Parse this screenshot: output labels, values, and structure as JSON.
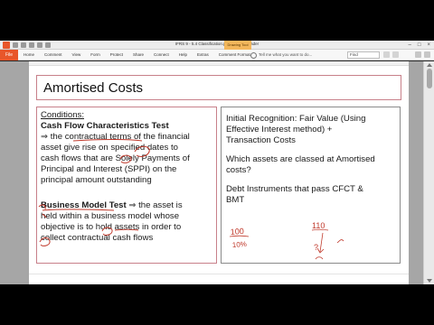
{
  "window": {
    "title": "IFRS 9 - 5.4 Classification.pdf * - Foxit Reader",
    "tool_tab": "Drawing Tool",
    "controls": [
      "–",
      "□",
      "×"
    ]
  },
  "ribbon": {
    "file_tab": "File",
    "tabs": [
      "Home",
      "Comment",
      "View",
      "Form",
      "Protect",
      "Share",
      "Connect",
      "Help",
      "Extras",
      "Comment Format"
    ],
    "tell_me": "Tell me what you want to do...",
    "find_value": "Find"
  },
  "slide": {
    "title": "Amortised Costs",
    "left": {
      "conditions_label": "Conditions:",
      "cfct_heading": "Cash Flow Characteristics Test",
      "cfct_lines": [
        "⇒ the contractual terms of the financial",
        "asset give rise on specified dates to",
        "cash flows that are Solely Payments of",
        "Principal and Interest (SPPI) on the",
        "principal amount outstanding"
      ],
      "bmt_heading": "Business Model Test",
      "bmt_lines": [
        " ⇒ the asset is",
        "held within a business model whose",
        "objective is to hold assets in order to",
        "collect contractual cash flows"
      ]
    },
    "right": {
      "lines": [
        "Initial Recognition: Fair Value (Using",
        "Effective Interest method) +",
        "Transaction Costs",
        "Which assets are classed at Amortised",
        "costs?",
        "Debt Instruments that pass CFCT &",
        "BMT"
      ],
      "handwriting": [
        "100",
        "10%",
        "110",
        "?"
      ]
    }
  },
  "colors": {
    "ink": "#c0392b",
    "box_border": "#c8808a",
    "file_tab": "#e8562a",
    "tool_tab": "#f3b75c"
  }
}
